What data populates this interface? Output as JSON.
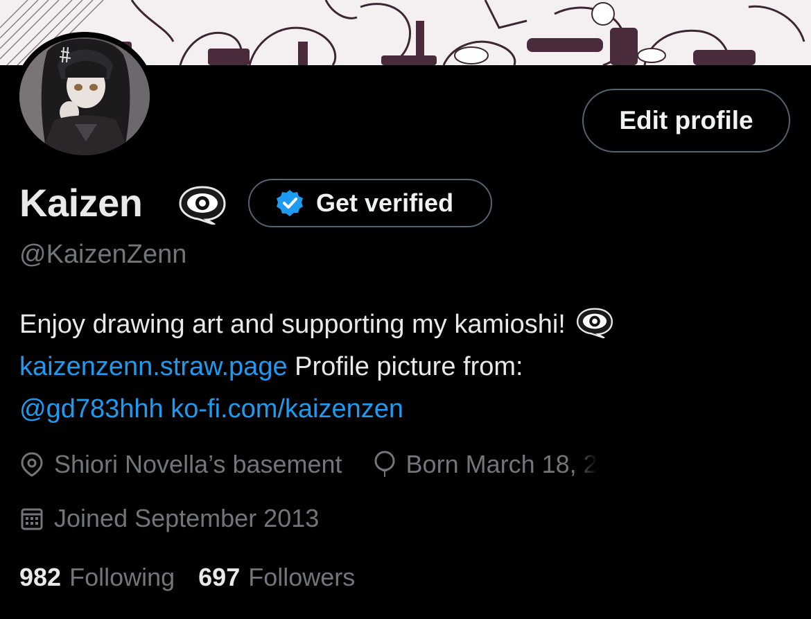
{
  "profile": {
    "display_name": "Kaizen",
    "handle": "@KaizenZenn",
    "edit_label": "Edit profile",
    "verify_label": "Get verified"
  },
  "bio": {
    "text1": "Enjoy drawing art and supporting my kamioshi!",
    "link1": "kaizenzenn.straw.page",
    "text2": " Profile picture from:",
    "link2": "@gd783hhh",
    "link3": "ko-fi.com/kaizenzen"
  },
  "meta": {
    "location": "Shiori Novella’s basement",
    "birthday": "Born March 18, 2",
    "joined": "Joined September 2013"
  },
  "stats": {
    "following_count": "982",
    "following_label": "Following",
    "followers_count": "697",
    "followers_label": "Followers"
  },
  "colors": {
    "background": "#000000",
    "link": "#1d9bf0",
    "muted": "#71767b",
    "verify_badge": "#1d9bf0"
  }
}
